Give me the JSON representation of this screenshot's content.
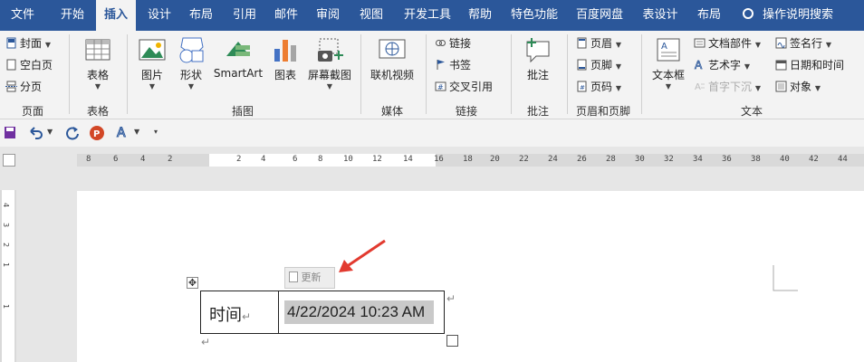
{
  "tabs": [
    {
      "label": "文件",
      "active": false
    },
    {
      "label": "开始",
      "active": false
    },
    {
      "label": "插入",
      "active": true
    },
    {
      "label": "设计",
      "active": false
    },
    {
      "label": "布局",
      "active": false
    },
    {
      "label": "引用",
      "active": false
    },
    {
      "label": "邮件",
      "active": false
    },
    {
      "label": "审阅",
      "active": false
    },
    {
      "label": "视图",
      "active": false
    },
    {
      "label": "开发工具",
      "active": false
    },
    {
      "label": "帮助",
      "active": false
    },
    {
      "label": "特色功能",
      "active": false
    },
    {
      "label": "百度网盘",
      "active": false
    },
    {
      "label": "表设计",
      "active": false
    },
    {
      "label": "布局",
      "active": false
    }
  ],
  "tell_me": "操作说明搜索",
  "ribbon": {
    "pages": {
      "label": "页面",
      "items": [
        "封面",
        "空白页",
        "分页"
      ]
    },
    "tables": {
      "label": "表格",
      "button": "表格"
    },
    "illustrations": {
      "label": "插图",
      "items": [
        "图片",
        "形状",
        "SmartArt",
        "图表",
        "屏幕截图"
      ]
    },
    "media": {
      "label": "媒体",
      "button": "联机视频"
    },
    "links": {
      "label": "链接",
      "items": [
        "链接",
        "书签",
        "交叉引用"
      ]
    },
    "comments": {
      "label": "批注",
      "button": "批注"
    },
    "header_footer": {
      "label": "页眉和页脚",
      "items": [
        "页眉",
        "页脚",
        "页码"
      ]
    },
    "text": {
      "label": "文本",
      "textbox": "文本框",
      "items": [
        "文档部件",
        "艺术字",
        "首字下沉"
      ],
      "items_right": [
        "签名行",
        "日期和时间",
        "对象"
      ]
    }
  },
  "ruler_numbers": [
    "8",
    "6",
    "4",
    "2",
    "2",
    "4",
    "6",
    "8",
    "10",
    "12",
    "14",
    "16",
    "18",
    "20",
    "22",
    "24",
    "26",
    "28",
    "30",
    "32",
    "34",
    "36",
    "38",
    "40",
    "42",
    "44"
  ],
  "vruler_numbers": [
    "4",
    "3",
    "2",
    "1",
    "1"
  ],
  "document": {
    "cell_label": "时间",
    "date_field": "4/22/2024 10:23 AM",
    "update_button": "更新"
  },
  "colors": {
    "tab_bar": "#2b579a",
    "ribbon": "#f3f3f3",
    "field_shade": "#c9c9c9",
    "arrow": "#e23a2f"
  }
}
